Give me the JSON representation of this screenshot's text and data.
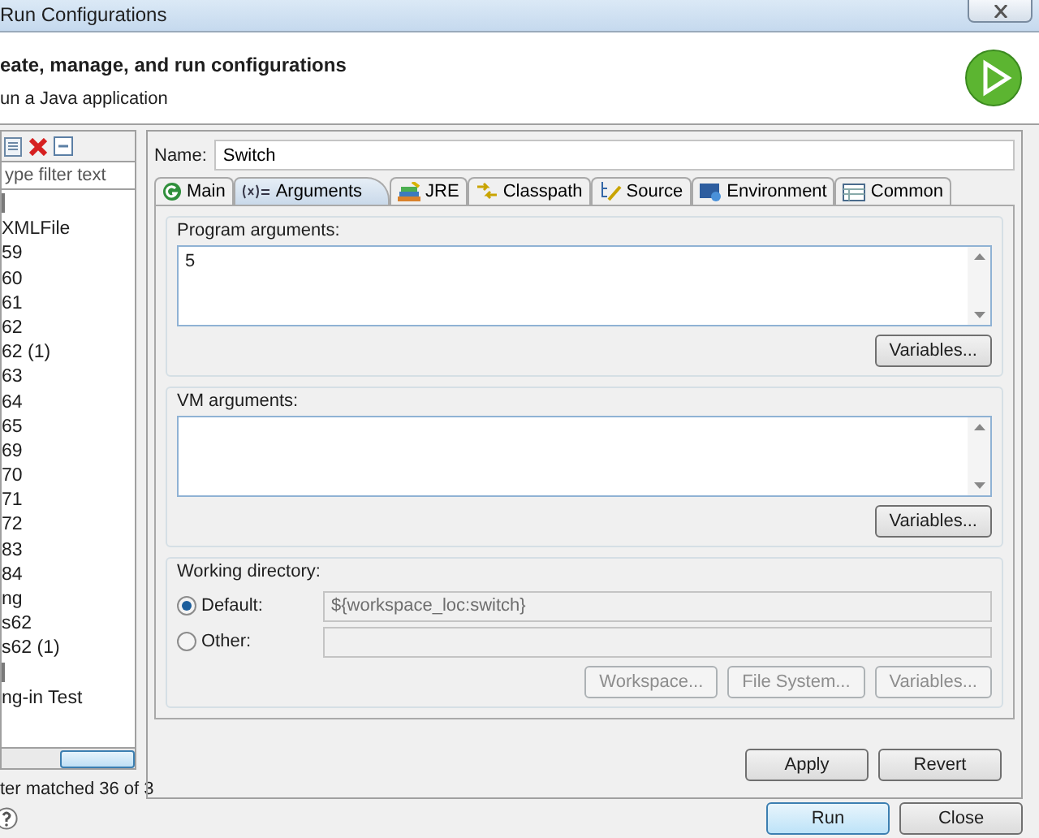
{
  "window": {
    "title": "Run Configurations"
  },
  "header": {
    "title": "eate, manage, and run configurations",
    "subtitle": "un a Java application"
  },
  "sidebar": {
    "filter_placeholder": "ype filter text",
    "items": [
      {
        "kind": "icon-only"
      },
      {
        "kind": "text",
        "label": "XMLFile"
      },
      {
        "kind": "text",
        "label": "59"
      },
      {
        "kind": "text",
        "label": "60"
      },
      {
        "kind": "text",
        "label": "61"
      },
      {
        "kind": "text",
        "label": "62"
      },
      {
        "kind": "text",
        "label": "62 (1)"
      },
      {
        "kind": "text",
        "label": "63"
      },
      {
        "kind": "text",
        "label": "64"
      },
      {
        "kind": "text",
        "label": "65"
      },
      {
        "kind": "text",
        "label": "69"
      },
      {
        "kind": "text",
        "label": "70"
      },
      {
        "kind": "text",
        "label": "71"
      },
      {
        "kind": "text",
        "label": "72"
      },
      {
        "kind": "text",
        "label": "83"
      },
      {
        "kind": "text",
        "label": "84"
      },
      {
        "kind": "text",
        "label": "ng"
      },
      {
        "kind": "text",
        "label": "s62"
      },
      {
        "kind": "text",
        "label": "s62 (1)"
      },
      {
        "kind": "icon-only"
      },
      {
        "kind": "text",
        "label": "ng-in Test"
      }
    ],
    "status": "ter matched 36 of 3"
  },
  "name_field": {
    "label": "Name:",
    "value": "Switch"
  },
  "tabs": [
    {
      "kind": "main",
      "label": "Main",
      "selected": false
    },
    {
      "kind": "arguments",
      "label": "Arguments",
      "selected": true
    },
    {
      "kind": "jre",
      "label": "JRE",
      "selected": false
    },
    {
      "kind": "classpath",
      "label": "Classpath",
      "selected": false
    },
    {
      "kind": "source",
      "label": "Source",
      "selected": false
    },
    {
      "kind": "environment",
      "label": "Environment",
      "selected": false
    },
    {
      "kind": "common",
      "label": "Common",
      "selected": false
    }
  ],
  "program_arguments": {
    "label": "Program arguments:",
    "value": "5",
    "button": {
      "label": "Variables...",
      "disabled": false
    }
  },
  "vm_arguments": {
    "label": "VM arguments:",
    "button": {
      "label": "Variables...",
      "disabled": false
    }
  },
  "working_directory": {
    "label": "Working directory:",
    "options": [
      {
        "label": "Default:",
        "selected": true,
        "value": "${workspace_loc:switch}"
      },
      {
        "label": "Other:",
        "selected": false
      }
    ],
    "buttons": [
      {
        "label": "Workspace...",
        "disabled": true
      },
      {
        "label": "File System...",
        "disabled": true
      },
      {
        "label": "Variables...",
        "disabled": true
      }
    ]
  },
  "actions": [
    {
      "label": "Apply",
      "disabled": false
    },
    {
      "label": "Revert",
      "disabled": false
    }
  ],
  "footer_buttons": [
    {
      "label": "Run",
      "default": true
    },
    {
      "label": "Close",
      "default": false
    }
  ]
}
